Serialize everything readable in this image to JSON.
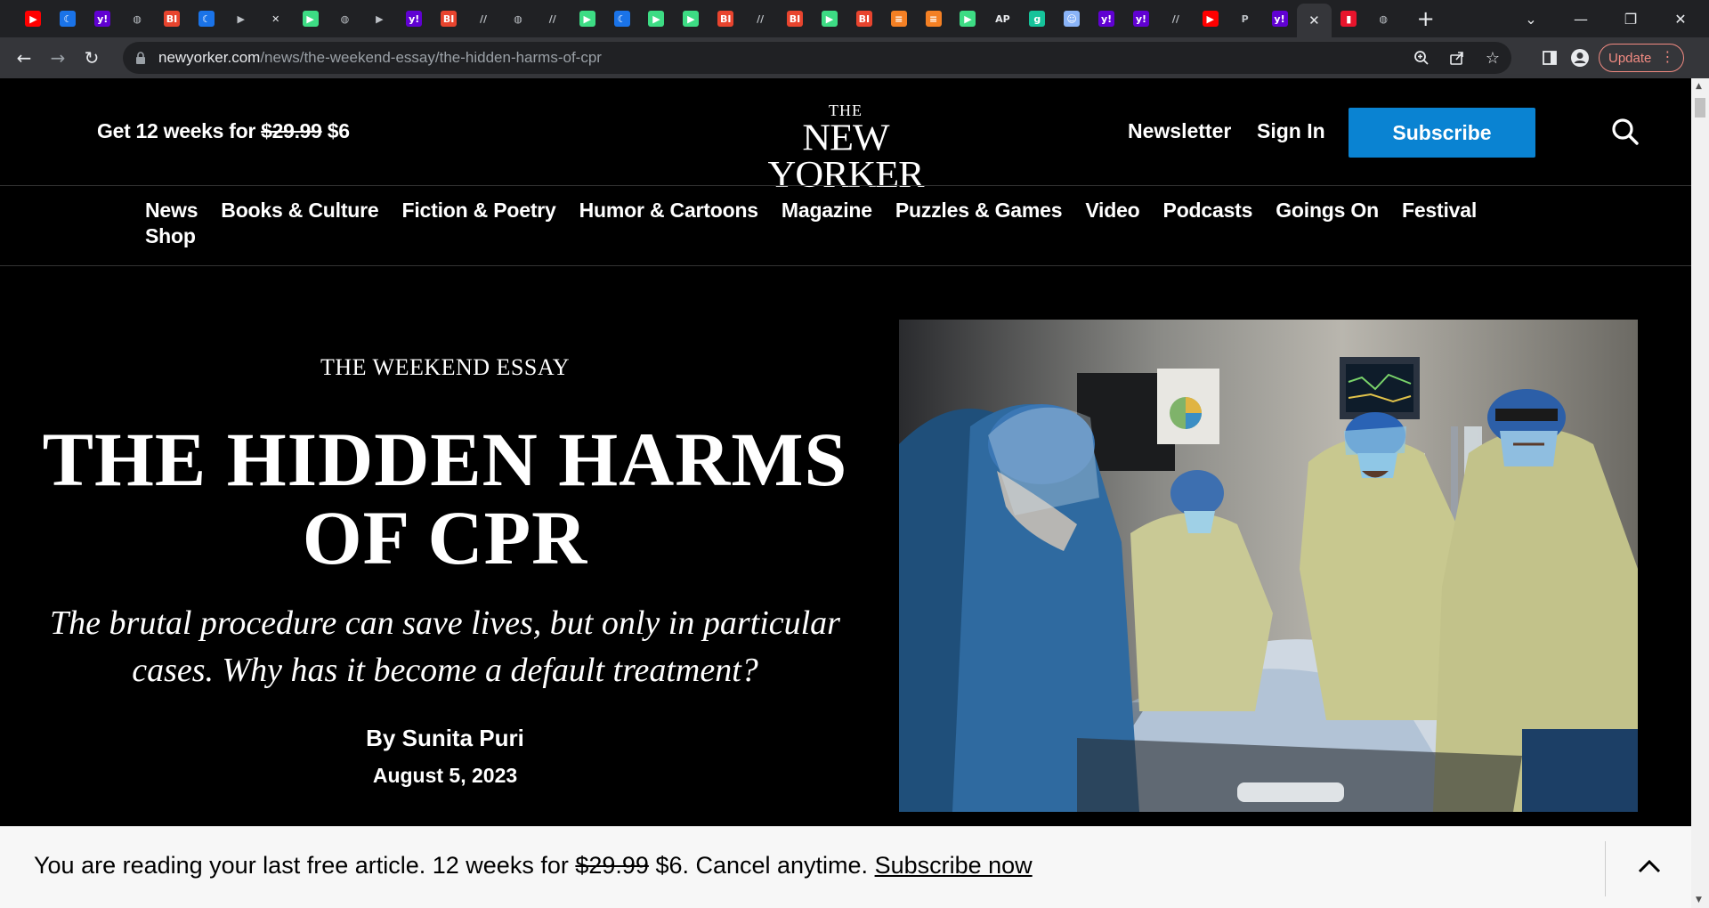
{
  "browser": {
    "tabs": [
      {
        "icon": "youtube-icon",
        "color": "#ff0000",
        "glyph": "▶"
      },
      {
        "icon": "moon-icon",
        "color": "#1a73e8",
        "glyph": "☾"
      },
      {
        "icon": "yahoo-icon",
        "color": "#6001d2",
        "glyph": "y!"
      },
      {
        "icon": "globe-icon",
        "color": "#5f6368",
        "glyph": "◍"
      },
      {
        "icon": "business-insider-icon",
        "color": "#e8442e",
        "glyph": "BI"
      },
      {
        "icon": "moon-icon",
        "color": "#1a73e8",
        "glyph": "☾"
      },
      {
        "icon": "bookmark-icon",
        "color": "#5f6368",
        "glyph": "▶"
      },
      {
        "icon": "sheets-icon",
        "color": "#ffffff",
        "glyph": "✕"
      },
      {
        "icon": "play-circle-icon",
        "color": "#3ddc84",
        "glyph": "▶"
      },
      {
        "icon": "globe-icon",
        "color": "#5f6368",
        "glyph": "◍"
      },
      {
        "icon": "bookmark-icon",
        "color": "#5f6368",
        "glyph": "▶"
      },
      {
        "icon": "yahoo-icon",
        "color": "#6001d2",
        "glyph": "y!"
      },
      {
        "icon": "business-insider-icon",
        "color": "#e8442e",
        "glyph": "BI"
      },
      {
        "icon": "slashes-icon",
        "color": "#5f6368",
        "glyph": "//"
      },
      {
        "icon": "globe-icon",
        "color": "#5f6368",
        "glyph": "◍"
      },
      {
        "icon": "slashes-icon",
        "color": "#5f6368",
        "glyph": "//"
      },
      {
        "icon": "play-circle-icon",
        "color": "#3ddc84",
        "glyph": "▶"
      },
      {
        "icon": "moon-icon",
        "color": "#1a73e8",
        "glyph": "☾"
      },
      {
        "icon": "play-circle-icon",
        "color": "#3ddc84",
        "glyph": "▶"
      },
      {
        "icon": "play-circle-icon",
        "color": "#3ddc84",
        "glyph": "▶"
      },
      {
        "icon": "business-insider-icon",
        "color": "#e8442e",
        "glyph": "BI"
      },
      {
        "icon": "slashes-icon",
        "color": "#5f6368",
        "glyph": "//"
      },
      {
        "icon": "business-insider-icon",
        "color": "#e8442e",
        "glyph": "BI"
      },
      {
        "icon": "play-circle-icon",
        "color": "#3ddc84",
        "glyph": "▶"
      },
      {
        "icon": "business-insider-icon",
        "color": "#e8442e",
        "glyph": "BI"
      },
      {
        "icon": "stack-icon",
        "color": "#f48024",
        "glyph": "≡"
      },
      {
        "icon": "stack-icon",
        "color": "#f48024",
        "glyph": "≡"
      },
      {
        "icon": "play-circle-icon",
        "color": "#3ddc84",
        "glyph": "▶"
      },
      {
        "icon": "news-icon",
        "color": "#ffffff",
        "glyph": "AP"
      },
      {
        "icon": "grammarly-icon",
        "color": "#15c39a",
        "glyph": "g"
      },
      {
        "icon": "person-icon",
        "color": "#8ab4f8",
        "glyph": "☺"
      },
      {
        "icon": "yahoo-icon",
        "color": "#6001d2",
        "glyph": "y!"
      },
      {
        "icon": "yahoo-icon",
        "color": "#6001d2",
        "glyph": "y!"
      },
      {
        "icon": "slashes-icon",
        "color": "#5f6368",
        "glyph": "//"
      },
      {
        "icon": "youtube-icon",
        "color": "#ff0000",
        "glyph": "▶"
      },
      {
        "icon": "p-icon",
        "color": "#3c4043",
        "glyph": "P"
      },
      {
        "icon": "yahoo-icon",
        "color": "#6001d2",
        "glyph": "y!"
      },
      {
        "icon": "close-icon",
        "color": "#e8eaed",
        "glyph": "✕",
        "active": true
      },
      {
        "icon": "mic-icon",
        "color": "#e8142c",
        "glyph": "▮"
      },
      {
        "icon": "globe-icon",
        "color": "#5f6368",
        "glyph": "◍"
      }
    ],
    "new_tab": "+",
    "url_domain": "newyorker.com",
    "url_path": "/news/the-weekend-essay/the-hidden-harms-of-cpr",
    "update_label": "Update"
  },
  "header": {
    "promo_prefix": "Get 12 weeks for ",
    "promo_old_price": "$29.99",
    "promo_new_price": " $6",
    "logo_the": "THE",
    "logo_name": "NEW YORKER",
    "newsletter": "Newsletter",
    "sign_in": "Sign In",
    "subscribe": "Subscribe"
  },
  "nav": {
    "items": [
      "News",
      "Books & Culture",
      "Fiction & Poetry",
      "Humor & Cartoons",
      "Magazine",
      "Puzzles & Games",
      "Video",
      "Podcasts",
      "Goings On",
      "Festival",
      "Shop"
    ]
  },
  "article": {
    "rubric": "THE WEEKEND ESSAY",
    "headline": "THE HIDDEN HARMS OF CPR",
    "dek": "The brutal procedure can save lives, but only in particular cases. Why has it become a default treatment?",
    "byline": "By Sunita Puri",
    "date": "August 5, 2023"
  },
  "paywall": {
    "text_prefix": "You are reading your last free article. 12 weeks for ",
    "old_price": "$29.99",
    "text_suffix": " $6. Cancel anytime. ",
    "link": "Subscribe now"
  },
  "colors": {
    "accent": "#0a83d2",
    "page_bg": "#000000",
    "paywall_bg": "#f7f7f7"
  }
}
